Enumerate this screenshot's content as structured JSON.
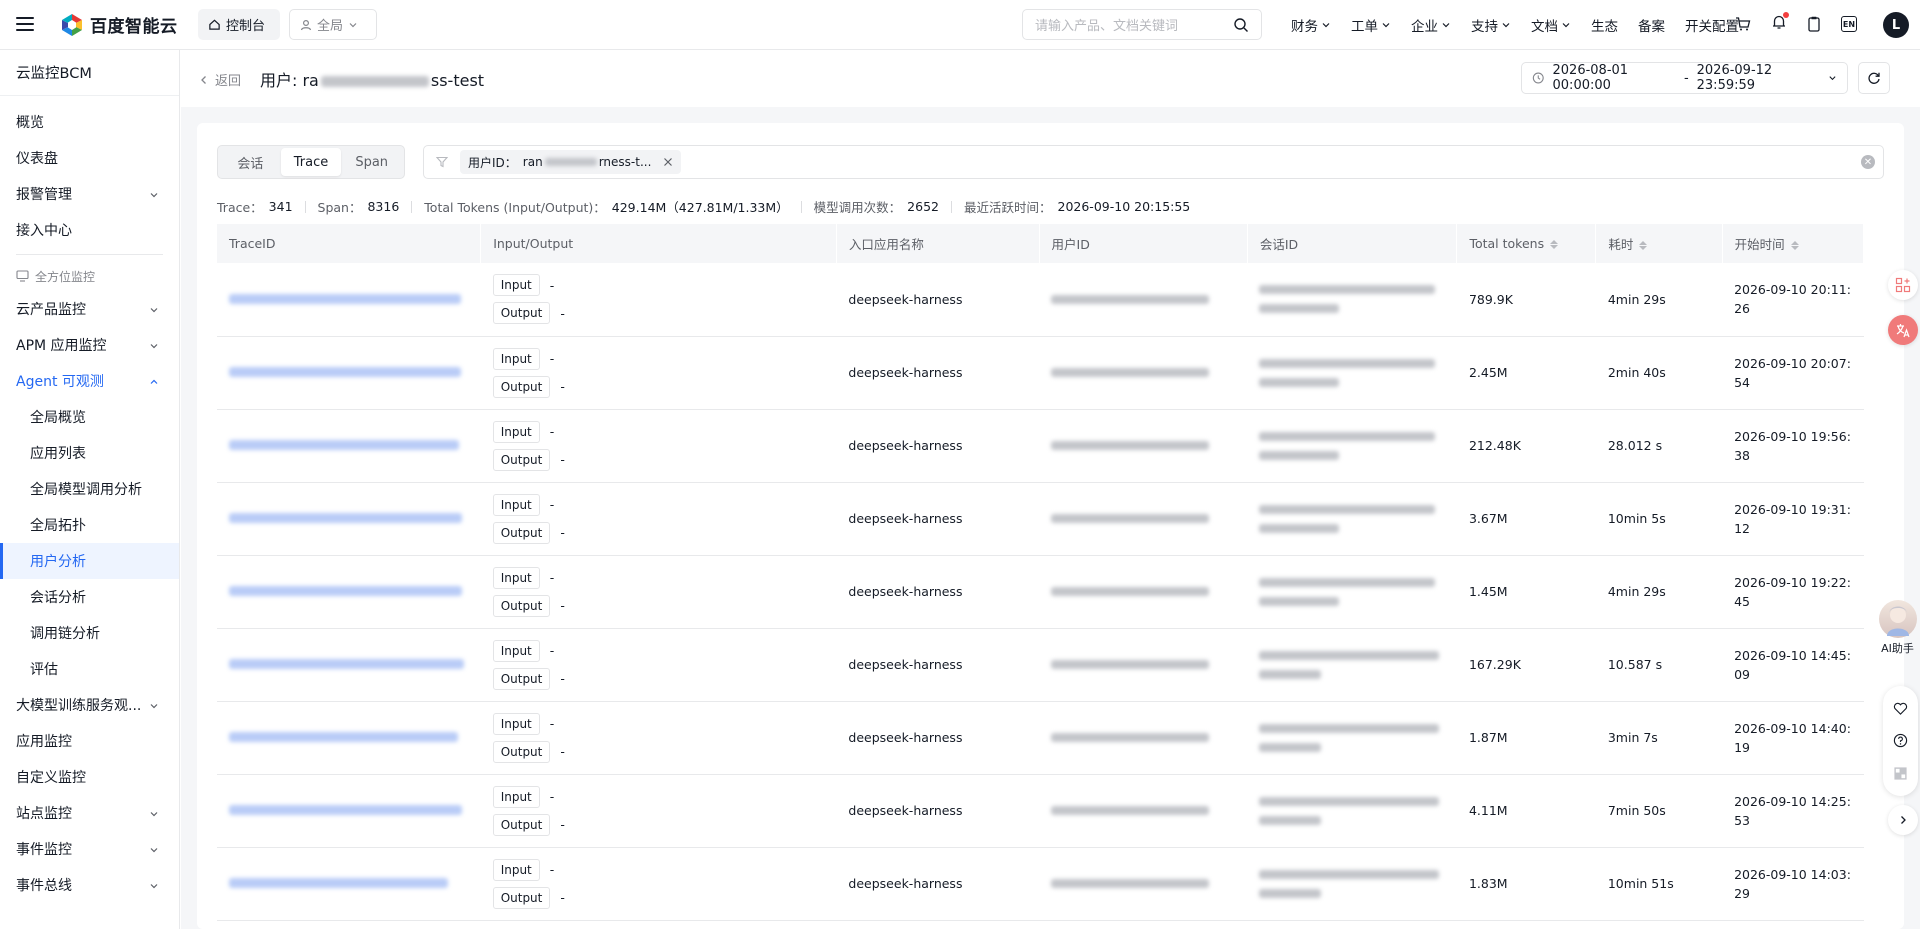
{
  "topbar": {
    "logo_text": "百度智能云",
    "console_label": "控制台",
    "scope_label": "全局",
    "search_placeholder": "请输入产品、文档关键词",
    "nav": [
      "财务",
      "工单",
      "企业",
      "支持",
      "文档",
      "生态",
      "备案",
      "开关配置"
    ],
    "nav_has_dropdown": [
      true,
      true,
      true,
      true,
      true,
      false,
      false,
      false
    ],
    "lang_badge": "EN",
    "avatar_letter": "L"
  },
  "sidebar": {
    "title": "云监控BCM",
    "items_top": [
      "概览",
      "仪表盘",
      "报警管理",
      "接入中心"
    ],
    "group_label": "全方位监控",
    "items_mid": [
      "云产品监控",
      "APM 应用监控",
      "Agent 可观测"
    ],
    "agent_sub": [
      "全局概览",
      "应用列表",
      "全局模型调用分析",
      "全局拓扑",
      "用户分析",
      "会话分析",
      "调用链分析",
      "评估"
    ],
    "active_item": "用户分析",
    "items_bottom": [
      "大模型训练服务观...",
      "应用监控",
      "自定义监控",
      "站点监控",
      "事件监控",
      "事件总线"
    ]
  },
  "page": {
    "back_label": "返回",
    "title_prefix": "用户: ra",
    "title_suffix": "ss-test",
    "date_start": "2026-08-01 00:00:00",
    "date_sep": "-",
    "date_end": "2026-09-12 23:59:59"
  },
  "tabs": [
    "会话",
    "Trace",
    "Span"
  ],
  "active_tab": "Trace",
  "filter": {
    "tag_key": "用户ID：",
    "tag_value_prefix": "ran",
    "tag_value_suffix": "rness-t..."
  },
  "stats": [
    {
      "k": "Trace：",
      "v": "341"
    },
    {
      "k": "Span：",
      "v": "8316"
    },
    {
      "k": "Total Tokens (Input/Output)：",
      "v": "429.14M（427.81M/1.33M）"
    },
    {
      "k": "模型调用次数：",
      "v": "2652"
    },
    {
      "k": "最近活跃时间：",
      "v": "2026-09-10 20:15:55"
    }
  ],
  "table": {
    "columns": [
      "TraceID",
      "Input/Output",
      "入口应用名称",
      "用户ID",
      "会话ID",
      "Total tokens",
      "耗时",
      "开始时间"
    ],
    "sortable": [
      false,
      false,
      false,
      false,
      false,
      true,
      true,
      true
    ],
    "input_label": "Input",
    "output_label": "Output",
    "io_value": "-",
    "rows": [
      {
        "app": "deepseek-harness",
        "tokens": "789.9K",
        "duration": "4min 29s",
        "start": "2026-09-10 20:11:26"
      },
      {
        "app": "deepseek-harness",
        "tokens": "2.45M",
        "duration": "2min 40s",
        "start": "2026-09-10 20:07:54"
      },
      {
        "app": "deepseek-harness",
        "tokens": "212.48K",
        "duration": "28.012 s",
        "start": "2026-09-10 19:56:38"
      },
      {
        "app": "deepseek-harness",
        "tokens": "3.67M",
        "duration": "10min 5s",
        "start": "2026-09-10 19:31:12"
      },
      {
        "app": "deepseek-harness",
        "tokens": "1.45M",
        "duration": "4min 29s",
        "start": "2026-09-10 19:22:45"
      },
      {
        "app": "deepseek-harness",
        "tokens": "167.29K",
        "duration": "10.587 s",
        "start": "2026-09-10 14:45:09"
      },
      {
        "app": "deepseek-harness",
        "tokens": "1.87M",
        "duration": "3min 7s",
        "start": "2026-09-10 14:40:19"
      },
      {
        "app": "deepseek-harness",
        "tokens": "4.11M",
        "duration": "7min 50s",
        "start": "2026-09-10 14:25:53"
      },
      {
        "app": "deepseek-harness",
        "tokens": "1.83M",
        "duration": "10min 51s",
        "start": "2026-09-10 14:03:29"
      }
    ]
  },
  "assistant_label": "AI助手",
  "colors": {
    "accent": "#2468f2",
    "text": "#151b26",
    "muted": "#84868c",
    "bg": "#f5f6f8"
  }
}
